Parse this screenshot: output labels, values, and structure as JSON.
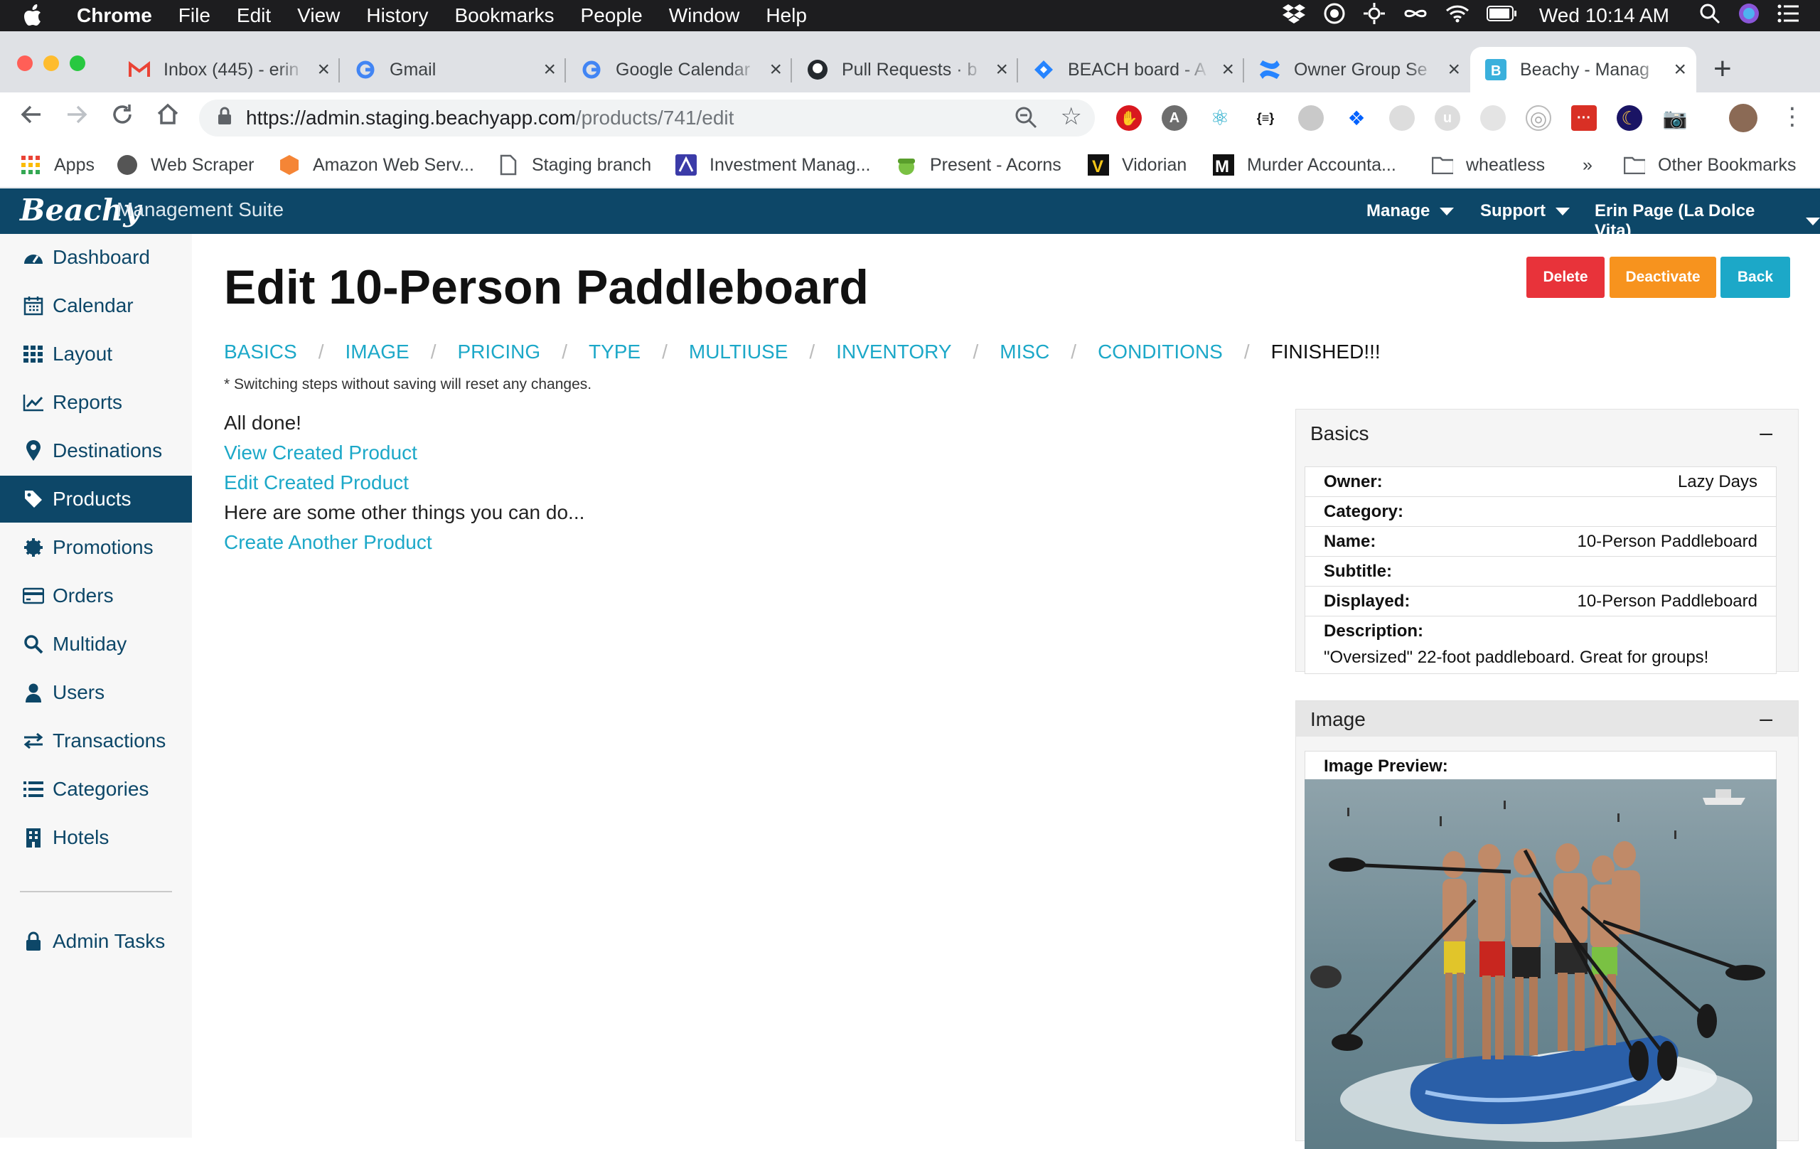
{
  "menubar": {
    "app": "Chrome",
    "items": [
      "File",
      "Edit",
      "View",
      "History",
      "Bookmarks",
      "People",
      "Window",
      "Help"
    ],
    "clock": "Wed 10:14 AM"
  },
  "tabs": [
    {
      "title": "Inbox (445) - erin",
      "icon": "gmail-icon"
    },
    {
      "title": "Gmail",
      "icon": "google-icon"
    },
    {
      "title": "Google Calendar",
      "icon": "google-icon"
    },
    {
      "title": "Pull Requests · b",
      "icon": "github-icon"
    },
    {
      "title": "BEACH board - A",
      "icon": "jira-icon"
    },
    {
      "title": "Owner Group Se",
      "icon": "confluence-icon"
    },
    {
      "title": "Beachy - Manag",
      "icon": "beachy-icon"
    }
  ],
  "omnibox": {
    "host": "https://admin.staging.beachyapp.com",
    "path": "/products/741/edit"
  },
  "bookmarks": [
    "Apps",
    "Web Scraper",
    "Amazon Web Serv...",
    "Staging branch",
    "Investment Manag...",
    "Present - Acorns",
    "Vidorian",
    "Murder Accounta...",
    "wheatless",
    "»",
    "Other Bookmarks"
  ],
  "header": {
    "brand": "Beachy",
    "suite": "Management Suite",
    "menus": [
      "Manage",
      "Support",
      "Erin Page (La Dolce Vita)"
    ]
  },
  "sidebar": {
    "items": [
      "Dashboard",
      "Calendar",
      "Layout",
      "Reports",
      "Destinations",
      "Products",
      "Promotions",
      "Orders",
      "Multiday",
      "Users",
      "Transactions",
      "Categories",
      "Hotels"
    ],
    "admin": "Admin Tasks"
  },
  "page": {
    "title": "Edit 10-Person Paddleboard",
    "buttons": {
      "delete": "Delete",
      "deactivate": "Deactivate",
      "back": "Back"
    },
    "steps": [
      "BASICS",
      "IMAGE",
      "PRICING",
      "TYPE",
      "MULTIUSE",
      "INVENTORY",
      "MISC",
      "CONDITIONS",
      "FINISHED!!!"
    ],
    "note": "* Switching steps without saving will reset any changes.",
    "done": {
      "all_done": "All done!",
      "view": "View Created Product",
      "edit": "Edit Created Product",
      "other": "Here are some other things you can do...",
      "create": "Create Another Product"
    }
  },
  "basics": {
    "title": "Basics",
    "toggle": "–",
    "rows": [
      {
        "k": "Owner:",
        "v": "Lazy Days"
      },
      {
        "k": "Category:",
        "v": ""
      },
      {
        "k": "Name:",
        "v": "10-Person Paddleboard"
      },
      {
        "k": "Subtitle:",
        "v": ""
      },
      {
        "k": "Displayed:",
        "v": "10-Person Paddleboard"
      }
    ],
    "desc_label": "Description:",
    "desc_value": "\"Oversized\" 22-foot paddleboard. Great for groups!"
  },
  "image": {
    "title": "Image",
    "toggle": "–",
    "preview_label": "Image Preview:"
  },
  "colors": {
    "navy": "#0d4768",
    "link": "#1ca8c8",
    "delete": "#e8333a",
    "deactivate": "#f7931e",
    "back": "#1ca8c8"
  }
}
